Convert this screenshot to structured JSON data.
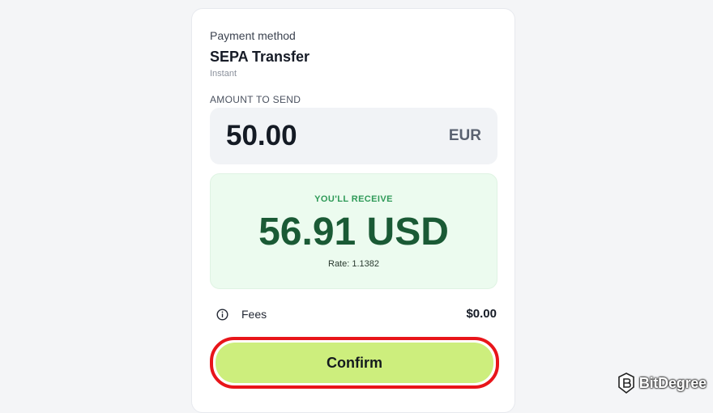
{
  "payment": {
    "label": "Payment method",
    "method": "SEPA Transfer",
    "speed": "Instant"
  },
  "amount": {
    "label": "AMOUNT TO SEND",
    "value": "50.00",
    "currency": "EUR"
  },
  "receive": {
    "label": "YOU'LL RECEIVE",
    "value": "56.91 USD",
    "rate": "Rate: 1.1382"
  },
  "fees": {
    "icon": "info-icon",
    "label": "Fees",
    "value": "$0.00"
  },
  "confirm": {
    "label": "Confirm",
    "highlight_color": "#e8151a",
    "button_color": "#cdee7d"
  },
  "watermark": {
    "text": "BitDegree"
  }
}
